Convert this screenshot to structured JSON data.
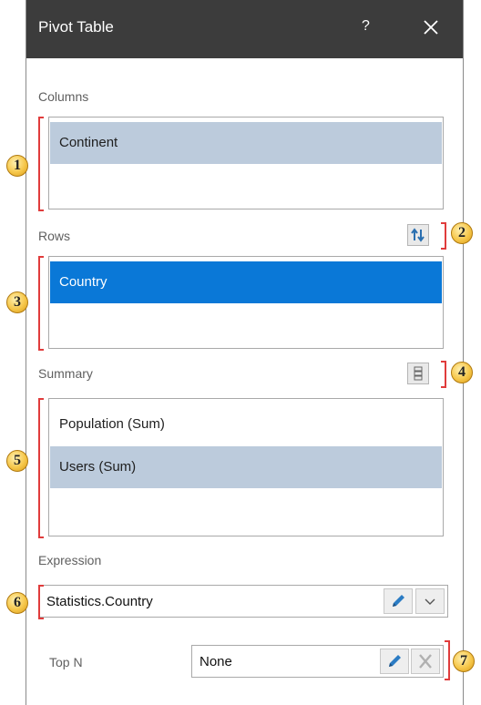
{
  "window": {
    "title": "Pivot Table",
    "help": "?"
  },
  "columns": {
    "label": "Columns",
    "items": [
      "Continent"
    ]
  },
  "rows": {
    "label": "Rows",
    "items": [
      "Country"
    ]
  },
  "summary": {
    "label": "Summary",
    "items": [
      "Population (Sum)",
      "Users (Sum)"
    ]
  },
  "expression": {
    "label": "Expression",
    "value": "Statistics.Country"
  },
  "topn": {
    "label": "Top N",
    "value": "None"
  },
  "annotations": [
    "1",
    "2",
    "3",
    "4",
    "5",
    "6",
    "7"
  ],
  "colors": {
    "titlebar": "#3c3c3c",
    "selection": "#0a78d7",
    "highlight": "#bccbdc",
    "annotation": "#e03c3c"
  }
}
